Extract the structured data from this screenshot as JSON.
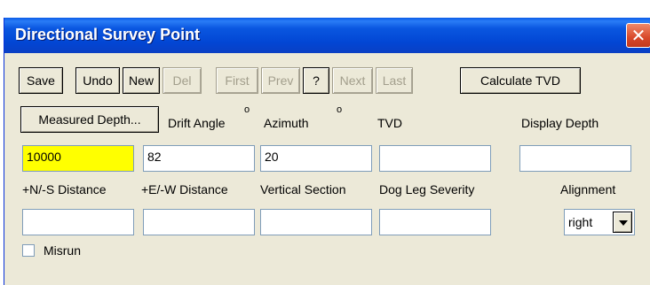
{
  "window": {
    "title": "Directional Survey Point",
    "close_icon": "close-icon"
  },
  "toolbar": {
    "save": "Save",
    "undo": "Undo",
    "new": "New",
    "del": "Del",
    "first": "First",
    "prev": "Prev",
    "help": "?",
    "next": "Next",
    "last": "Last",
    "calculate_tvd": "Calculate TVD"
  },
  "row1": {
    "measured_depth_button": "Measured Depth...",
    "drift_angle": "Drift Angle",
    "drift_angle_unit": "o",
    "azimuth": "Azimuth",
    "azimuth_unit": "o",
    "tvd": "TVD",
    "display_depth": "Display Depth"
  },
  "row1_values": {
    "measured_depth": "10000",
    "drift_angle": "82",
    "azimuth": "20",
    "tvd": "",
    "display_depth": ""
  },
  "row2": {
    "ns_distance": "+N/-S Distance",
    "ew_distance": "+E/-W Distance",
    "vertical_section": "Vertical Section",
    "dog_leg_severity": "Dog Leg Severity",
    "alignment": "Alignment"
  },
  "row2_values": {
    "ns_distance": "",
    "ew_distance": "",
    "vertical_section": "",
    "dog_leg_severity": "",
    "alignment": "right"
  },
  "misrun": {
    "label": "Misrun",
    "checked": false
  },
  "colors": {
    "titlebar": "#0a57e0",
    "highlight_field": "#ffff00",
    "dialog_bg": "#ece9d8"
  }
}
